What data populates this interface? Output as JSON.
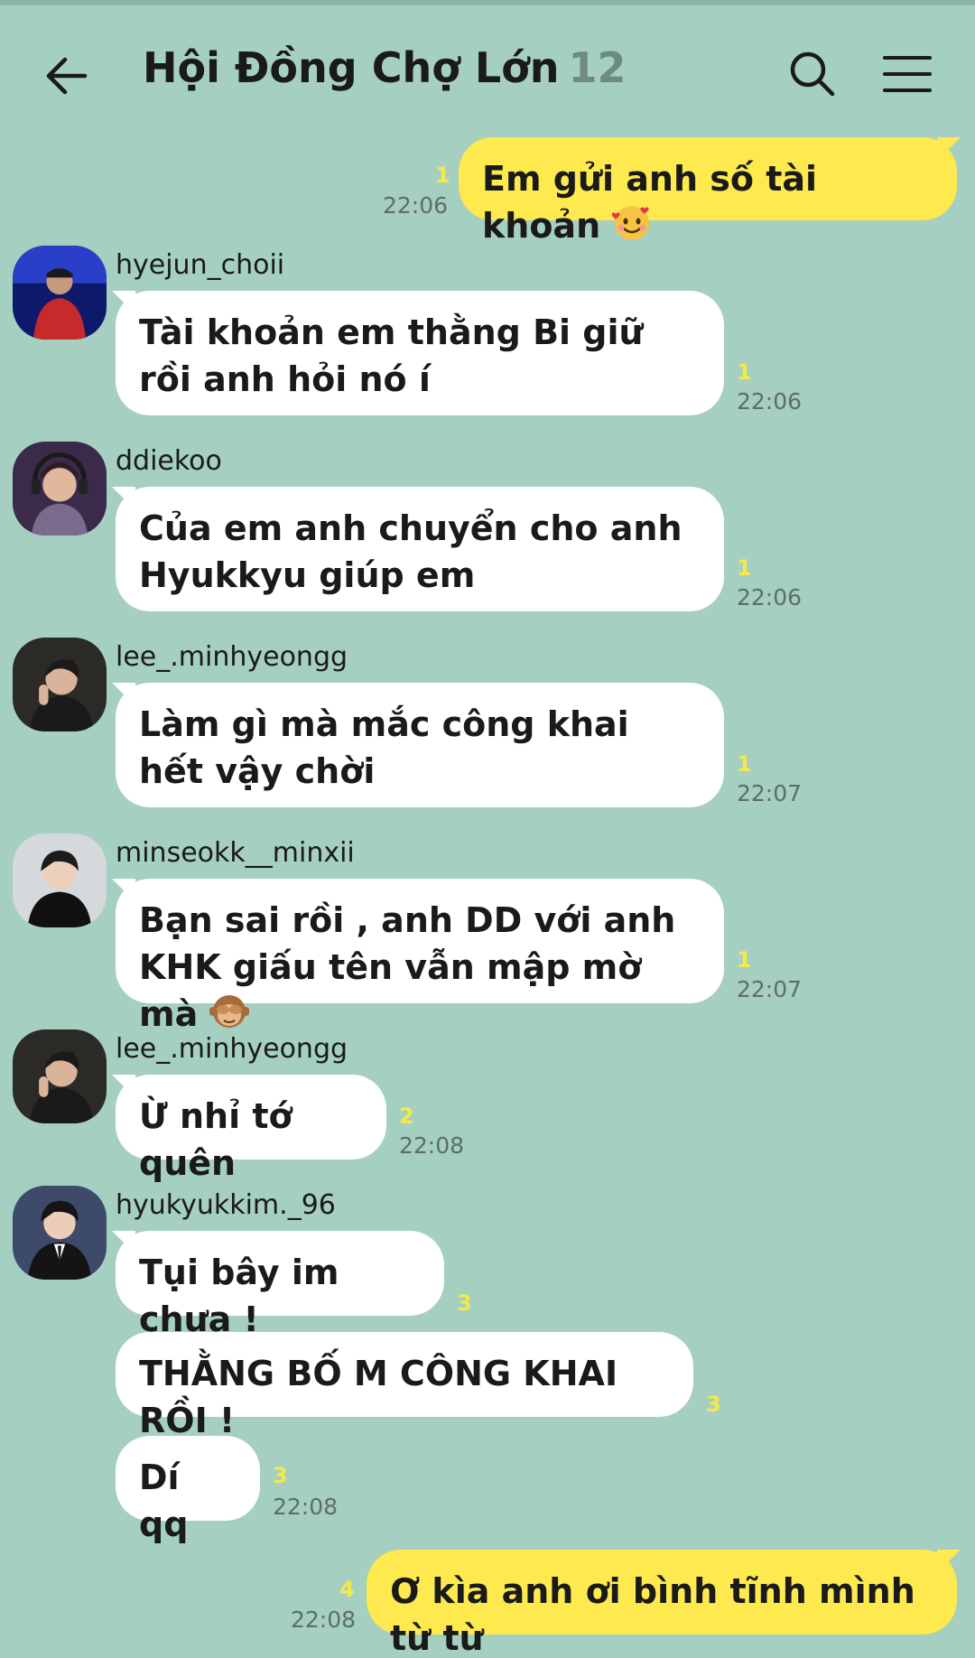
{
  "header": {
    "title": "Hội Đồng Chợ Lớn",
    "member_count": "12",
    "back_icon": "arrow-left-icon",
    "search_icon": "search-icon",
    "menu_icon": "hamburger-menu-icon"
  },
  "colors": {
    "background": "#a5cfc1",
    "my_bubble": "#fee94f",
    "other_bubble": "#ffffff",
    "unread": "#f5e94a",
    "time": "#5d6e68"
  },
  "messages": [
    {
      "sender": "me",
      "text": "Em gửi anh số tài khoản",
      "emoji": "smiling-face-with-hearts",
      "unread": "1",
      "time": "22:06"
    },
    {
      "sender": "hyejun_choii",
      "text": "Tài khoản em thằng Bi giữ rồi anh hỏi nó í",
      "unread": "1",
      "time": "22:06"
    },
    {
      "sender": "ddiekoo",
      "text": "Của em anh chuyển cho anh Hyukkyu giúp em",
      "unread": "1",
      "time": "22:06"
    },
    {
      "sender": "lee_.minhyeongg",
      "text": "Làm gì mà mắc công khai hết vậy chời",
      "unread": "1",
      "time": "22:07"
    },
    {
      "sender": "minseokk__minxii",
      "text": "Bạn sai rồi , anh DD với anh KHK giấu tên vẫn mập mờ mà",
      "emoji": "see-no-evil-monkey",
      "unread": "1",
      "time": "22:07"
    },
    {
      "sender": "lee_.minhyeongg",
      "text": "Ừ nhỉ tớ quên",
      "unread": "2",
      "time": "22:08"
    },
    {
      "sender": "hyukyukkim._96",
      "text": "Tụi bây im chưa !",
      "unread": "3"
    },
    {
      "sender": "hyukyukkim._96",
      "text": "THẰNG BỐ M CÔNG KHAI RỒI !",
      "unread": "3"
    },
    {
      "sender": "hyukyukkim._96",
      "text": "Dí qq",
      "unread": "3",
      "time": "22:08"
    },
    {
      "sender": "me",
      "text": "Ơ kìa anh ơi bình tĩnh mình từ từ",
      "unread": "4",
      "time": "22:08"
    }
  ]
}
